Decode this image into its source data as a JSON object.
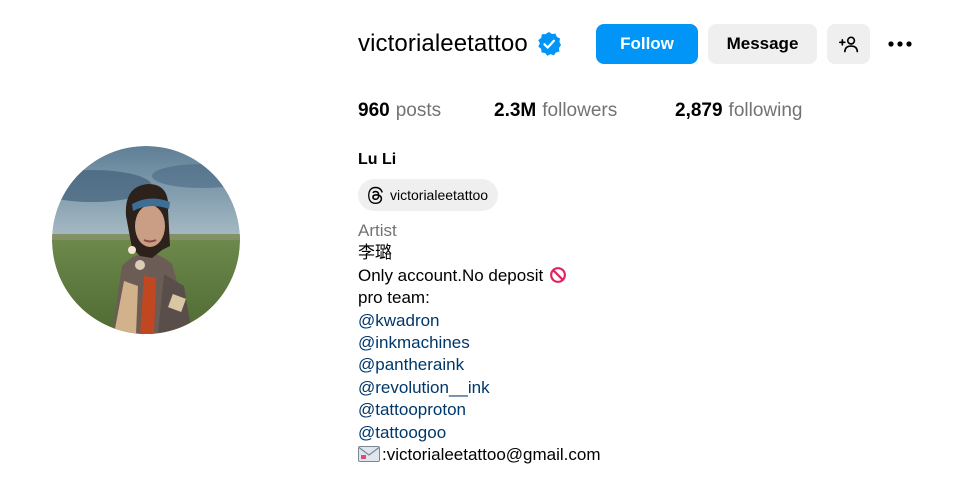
{
  "profile": {
    "username": "victorialeetattoo",
    "full_name": "Lu Li",
    "threads_handle": "victorialeetattoo",
    "category": "Artist"
  },
  "actions": {
    "follow_label": "Follow",
    "message_label": "Message"
  },
  "stats": {
    "posts": {
      "count": "960",
      "label": "posts"
    },
    "followers": {
      "count": "2.3M",
      "label": "followers"
    },
    "following": {
      "count": "2,879",
      "label": "following"
    }
  },
  "bio": {
    "line1": "李璐",
    "line2": "Only account.No deposit",
    "line3": "pro team:",
    "mentions": [
      "@kwadron",
      "@inkmachines",
      "@pantheraink",
      "@revolution__ink",
      "@tattooproton",
      "@tattoogoo"
    ],
    "email": ":victorialeetattoo@gmail.com"
  },
  "colors": {
    "accent": "#0095f6",
    "mention": "#00376b",
    "secondary_text": "#737373",
    "button_bg": "#efefef"
  },
  "icons": {
    "verified": "verified-badge-icon",
    "add_user": "add-person-icon",
    "more": "more-options-icon",
    "threads": "threads-icon",
    "no_entry": "prohibited-icon",
    "email": "envelope-icon"
  }
}
